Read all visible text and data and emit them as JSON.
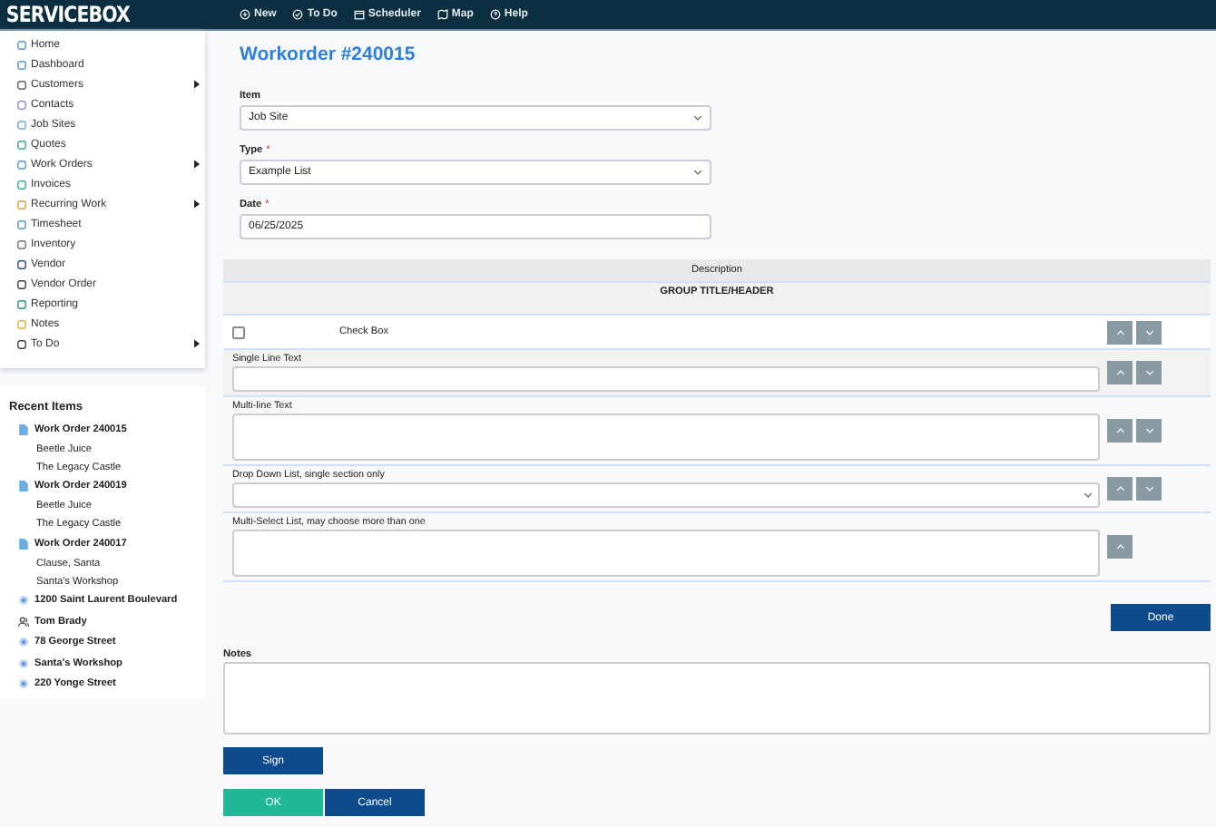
{
  "header": {
    "logo": "SERVICEBOX",
    "nav": [
      {
        "label": "New"
      },
      {
        "label": "To Do"
      },
      {
        "label": "Scheduler"
      },
      {
        "label": "Map"
      },
      {
        "label": "Help"
      }
    ]
  },
  "sidebar": {
    "items": [
      {
        "label": "Home",
        "has_submenu": false
      },
      {
        "label": "Dashboard",
        "has_submenu": false
      },
      {
        "label": "Customers",
        "has_submenu": true
      },
      {
        "label": "Contacts",
        "has_submenu": false
      },
      {
        "label": "Job Sites",
        "has_submenu": false
      },
      {
        "label": "Quotes",
        "has_submenu": false
      },
      {
        "label": "Work Orders",
        "has_submenu": true
      },
      {
        "label": "Invoices",
        "has_submenu": false
      },
      {
        "label": "Recurring Work",
        "has_submenu": true
      },
      {
        "label": "Timesheet",
        "has_submenu": false
      },
      {
        "label": "Inventory",
        "has_submenu": false
      },
      {
        "label": "Vendor",
        "has_submenu": false
      },
      {
        "label": "Vendor Order",
        "has_submenu": false
      },
      {
        "label": "Reporting",
        "has_submenu": false
      },
      {
        "label": "Notes",
        "has_submenu": false
      },
      {
        "label": "To Do",
        "has_submenu": true
      }
    ]
  },
  "recent": {
    "title": "Recent Items",
    "items": [
      {
        "kind": "workorder",
        "title": "Work Order 240015",
        "lines": [
          "Beetle Juice",
          "The Legacy Castle"
        ]
      },
      {
        "kind": "workorder",
        "title": "Work Order 240019",
        "lines": [
          "Beetle Juice",
          "The Legacy Castle"
        ]
      },
      {
        "kind": "workorder",
        "title": "Work Order 240017",
        "lines": [
          "Clause, Santa",
          "Santa's Workshop"
        ]
      },
      {
        "kind": "location",
        "title": "1200 Saint Laurent Boulevard"
      },
      {
        "kind": "person",
        "title": "Tom Brady"
      },
      {
        "kind": "location",
        "title": "78 George Street"
      },
      {
        "kind": "location",
        "title": "Santa's Workshop"
      },
      {
        "kind": "location",
        "title": "220 Yonge Street"
      }
    ]
  },
  "main": {
    "title": "Workorder #240015",
    "fields": [
      {
        "kind": "select",
        "label": "Item",
        "value": "Job Site"
      },
      {
        "kind": "select",
        "label": "Type",
        "required_mark": "*",
        "value": "Example List"
      },
      {
        "kind": "input",
        "label": "Date",
        "required_mark": "*",
        "value": "06/25/2025"
      }
    ],
    "table": {
      "column": "Description",
      "group_title": "GROUP TITLE/HEADER",
      "rows": [
        {
          "kind": "checkbox",
          "label": "Check Box",
          "checked": false,
          "move_up": true,
          "move_down": true
        },
        {
          "kind": "text",
          "label": "Single Line Text",
          "move_up": true,
          "move_down": true
        },
        {
          "kind": "textarea",
          "label": "Multi-line Text",
          "move_up": true,
          "move_down": true
        },
        {
          "kind": "select",
          "label": "Drop Down List, single section only",
          "move_up": true,
          "move_down": true
        },
        {
          "kind": "multiselect",
          "label": "Multi-Select List, may choose more than one",
          "move_up": true,
          "move_down": false
        }
      ]
    },
    "done": "Done",
    "notes_label": "Notes",
    "sign": "Sign",
    "ok": "OK",
    "cancel": "Cancel"
  }
}
